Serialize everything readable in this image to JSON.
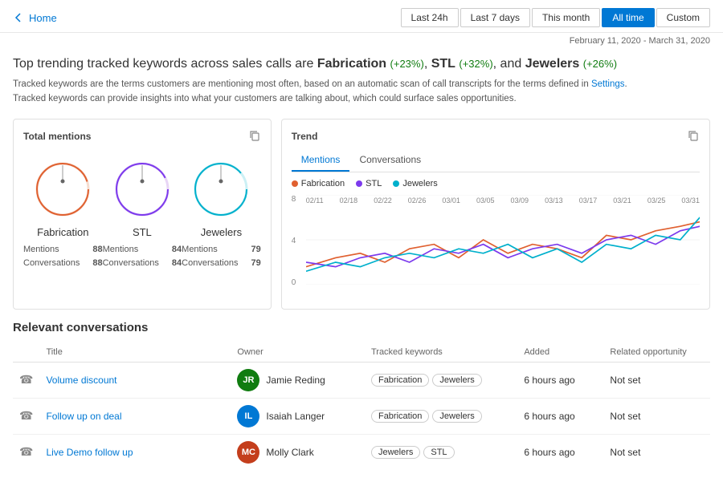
{
  "header": {
    "back_label": "Home",
    "time_filters": [
      "Last 24h",
      "Last 7 days",
      "This month",
      "All time",
      "Custom"
    ],
    "active_filter": "All time",
    "date_range": "February 11, 2020 - March 31, 2020"
  },
  "headline": {
    "prefix": "Top trending tracked keywords across sales calls are ",
    "kw1": "Fabrication",
    "kw1_pct": "(+23%)",
    "kw2": "STL",
    "kw2_pct": "(+32%)",
    "kw3": "Jewelers",
    "kw3_pct": "(+26%)"
  },
  "info_lines": [
    "Tracked keywords are the terms customers are mentioning most often, based on an automatic scan of call transcripts for the terms defined in Settings.",
    "Tracked keywords can provide insights into what your customers are talking about, which could surface sales opportunities."
  ],
  "total_mentions": {
    "title": "Total mentions",
    "items": [
      {
        "label": "Fabrication",
        "mentions": 88,
        "conversations": 88,
        "color": "#e06030",
        "stroke_color": "#e06030"
      },
      {
        "label": "STL",
        "mentions": 84,
        "conversations": 84,
        "color": "#7c3aed",
        "stroke_color": "#7c3aed"
      },
      {
        "label": "Jewelers",
        "mentions": 79,
        "conversations": 79,
        "color": "#00b0cc",
        "stroke_color": "#00b0cc"
      }
    ]
  },
  "trend": {
    "title": "Trend",
    "tabs": [
      "Mentions",
      "Conversations"
    ],
    "active_tab": "Mentions",
    "legend": [
      {
        "label": "Fabrication",
        "color": "#e06030"
      },
      {
        "label": "STL",
        "color": "#7c3aed"
      },
      {
        "label": "Jewelers",
        "color": "#00b0cc"
      }
    ],
    "y_labels": [
      "8",
      "4",
      "0"
    ],
    "x_labels": [
      "02/11",
      "02/18",
      "02/22",
      "02/26",
      "03/01",
      "03/05",
      "03/09",
      "03/13",
      "03/17",
      "03/21",
      "03/25",
      "03/31"
    ]
  },
  "conversations": {
    "title": "Relevant conversations",
    "columns": [
      "Title",
      "Owner",
      "Tracked keywords",
      "Added",
      "Related opportunity"
    ],
    "rows": [
      {
        "phone": true,
        "title": "Volume discount",
        "avatar_initials": "JR",
        "avatar_class": "avatar-jr",
        "owner": "Jamie Reding",
        "keywords": [
          "Fabrication",
          "Jewelers"
        ],
        "added": "6 hours ago",
        "related": "Not set"
      },
      {
        "phone": true,
        "title": "Follow up on deal",
        "avatar_initials": "IL",
        "avatar_class": "avatar-il",
        "owner": "Isaiah Langer",
        "keywords": [
          "Fabrication",
          "Jewelers"
        ],
        "added": "6 hours ago",
        "related": "Not set"
      },
      {
        "phone": true,
        "title": "Live Demo follow up",
        "avatar_initials": "MC",
        "avatar_class": "avatar-mc",
        "owner": "Molly Clark",
        "keywords": [
          "Jewelers",
          "STL"
        ],
        "added": "6 hours ago",
        "related": "Not set"
      }
    ]
  }
}
